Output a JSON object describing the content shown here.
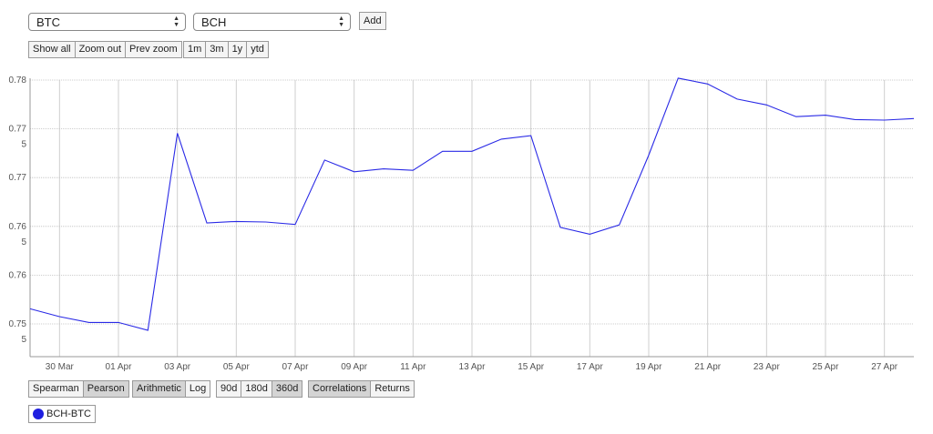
{
  "selectors": {
    "left_value": "BTC",
    "right_value": "BCH",
    "add_label": "Add"
  },
  "zoom_buttons": {
    "show_all": "Show all",
    "zoom_out": "Zoom out",
    "prev_zoom": "Prev zoom"
  },
  "range_buttons": [
    "1m",
    "3m",
    "1y",
    "ytd"
  ],
  "method_buttons": {
    "spearman": "Spearman",
    "pearson": "Pearson"
  },
  "scale_buttons": {
    "arithmetic": "Arithmetic",
    "log": "Log"
  },
  "window_buttons": {
    "d90": "90d",
    "d180": "180d",
    "d360": "360d"
  },
  "view_buttons": {
    "correlations": "Correlations",
    "returns": "Returns"
  },
  "legend": {
    "label": "BCH-BTC",
    "color": "#1f1fe0"
  },
  "chart_data": {
    "type": "line",
    "line_color": "#2a2ae6",
    "ylim": [
      0.7535,
      0.7789
    ],
    "yticks": [
      {
        "value": 0.7785,
        "line1": "0.78",
        "line2": ""
      },
      {
        "value": 0.7735,
        "line1": "0.77",
        "line2": "5"
      },
      {
        "value": 0.7685,
        "line1": "0.77",
        "line2": ""
      },
      {
        "value": 0.7635,
        "line1": "0.76",
        "line2": "5"
      },
      {
        "value": 0.7585,
        "line1": "0.76",
        "line2": ""
      },
      {
        "value": 0.7535,
        "line1": "0.75",
        "line2": "5"
      }
    ],
    "xticks": [
      {
        "day": 1,
        "label": "30 Mar"
      },
      {
        "day": 3,
        "label": "01 Apr"
      },
      {
        "day": 5,
        "label": "03 Apr"
      },
      {
        "day": 7,
        "label": "05 Apr"
      },
      {
        "day": 9,
        "label": "07 Apr"
      },
      {
        "day": 11,
        "label": "09 Apr"
      },
      {
        "day": 13,
        "label": "11 Apr"
      },
      {
        "day": 15,
        "label": "13 Apr"
      },
      {
        "day": 17,
        "label": "15 Apr"
      },
      {
        "day": 19,
        "label": "17 Apr"
      },
      {
        "day": 21,
        "label": "19 Apr"
      },
      {
        "day": 23,
        "label": "21 Apr"
      },
      {
        "day": 25,
        "label": "23 Apr"
      },
      {
        "day": 27,
        "label": "25 Apr"
      },
      {
        "day": 29,
        "label": "27 Apr"
      }
    ],
    "series": [
      {
        "name": "BCH-BTC",
        "x": [
          0,
          1,
          2,
          3,
          4,
          5,
          6,
          7,
          8,
          9,
          10,
          11,
          12,
          13,
          14,
          15,
          16,
          17,
          18,
          19,
          20,
          21,
          22,
          23,
          24,
          25,
          26,
          27,
          28,
          29,
          30
        ],
        "values": [
          0.75505,
          0.75425,
          0.75365,
          0.75365,
          0.75285,
          0.77305,
          0.76385,
          0.764,
          0.76395,
          0.7637,
          0.7703,
          0.7691,
          0.7694,
          0.76925,
          0.7712,
          0.7712,
          0.77245,
          0.7728,
          0.7634,
          0.7627,
          0.76365,
          0.7708,
          0.7787,
          0.7781,
          0.77655,
          0.77595,
          0.77475,
          0.7749,
          0.77445,
          0.7744,
          0.77455
        ]
      }
    ]
  }
}
